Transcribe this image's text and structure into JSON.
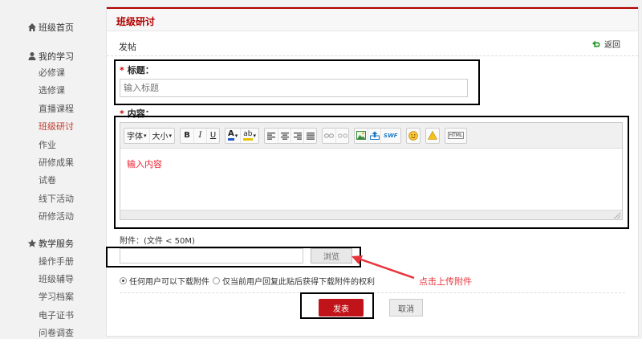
{
  "sidebar": {
    "home_label": "班级首页",
    "my_study": {
      "label": "我的学习",
      "items": [
        "必修课",
        "选修课",
        "直播课程",
        "班级研讨",
        "作业",
        "研修成果",
        "试卷",
        "线下活动",
        "研修活动"
      ],
      "active_index": 3
    },
    "teaching": {
      "label": "教学服务",
      "items": [
        "操作手册",
        "班级辅导",
        "学习档案",
        "电子证书",
        "问卷调查"
      ]
    }
  },
  "main": {
    "title": "班级研讨",
    "subtitle": "发帖",
    "back_label": "返回"
  },
  "form": {
    "title_label": "标题：",
    "title_placeholder": "输入标题",
    "content_label": "内容：",
    "required_mark": "*",
    "content_placeholder": "输入内容",
    "attach_label": "附件：(文件 < 50M)",
    "browse_label": "浏览",
    "radio_options": [
      "任何用户可以下载附件",
      "仅当前用户回复此贴后获得下载附件的权利"
    ],
    "radio_selected": 0,
    "submit_label": "发表",
    "cancel_label": "取消"
  },
  "toolbar": {
    "font_label": "字体",
    "size_label": "大小",
    "bold": "B",
    "italic": "I",
    "underline": "U",
    "font_color": "A",
    "highlight": "ab",
    "swf": "SWF",
    "html": "HTML"
  },
  "annotation": {
    "text": "点击上传附件"
  },
  "colors": {
    "accent": "#b30000",
    "submit": "#c1141a",
    "annotation": "#e8333a",
    "placeholder": "#e23"
  }
}
